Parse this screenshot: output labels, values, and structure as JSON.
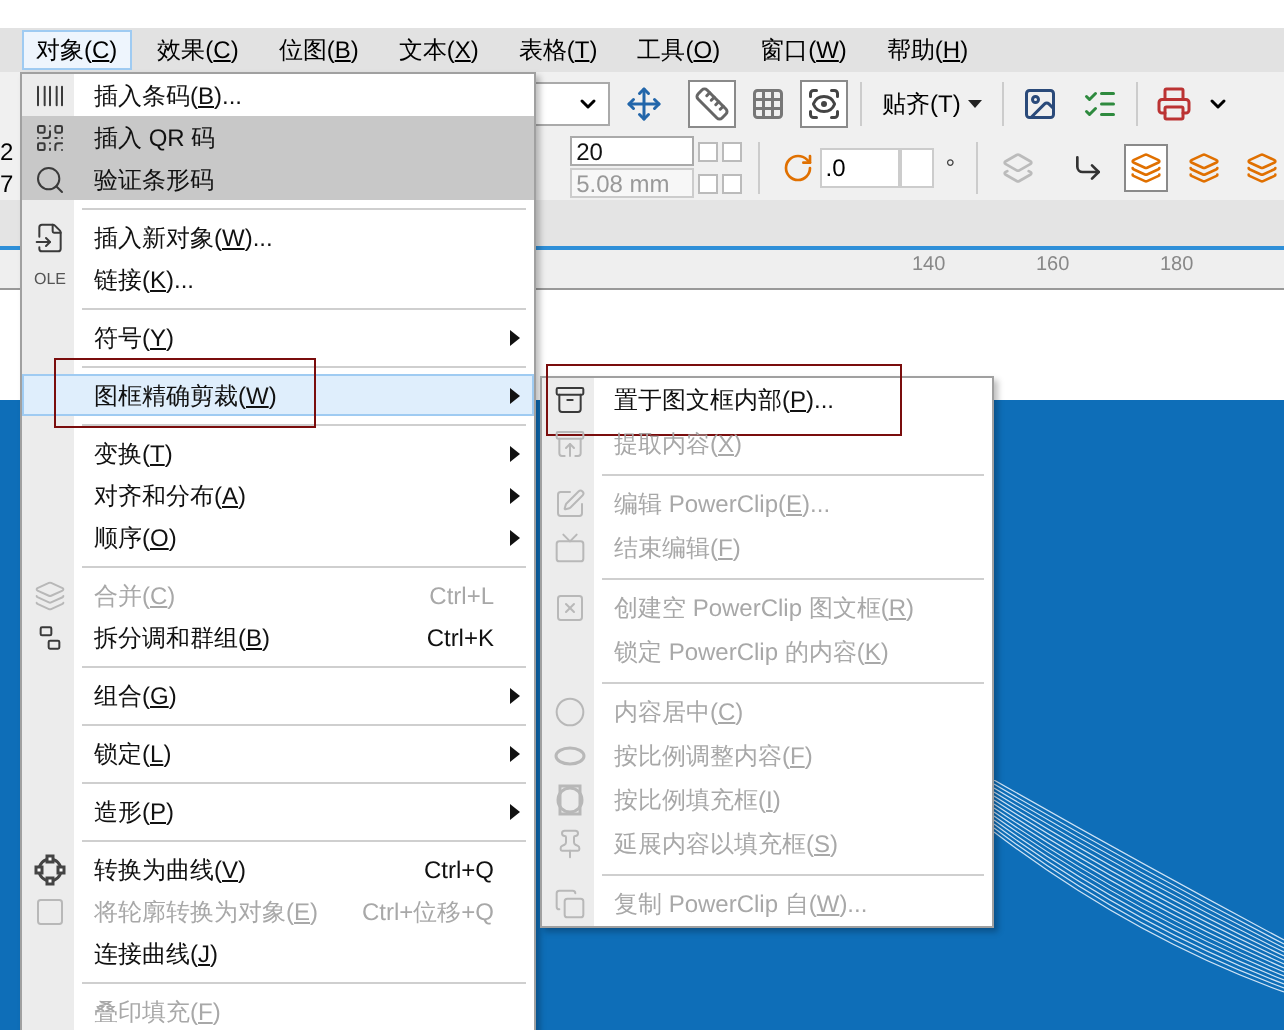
{
  "menu_bar": [
    {
      "label": "对象(C)",
      "selected": true
    },
    {
      "label": "效果(C)",
      "selected": false
    },
    {
      "label": "位图(B)",
      "selected": false
    },
    {
      "label": "文本(X)",
      "selected": false
    },
    {
      "label": "表格(T)",
      "selected": false
    },
    {
      "label": "工具(O)",
      "selected": false
    },
    {
      "label": "窗口(W)",
      "selected": false
    },
    {
      "label": "帮助(H)",
      "selected": false
    }
  ],
  "toolbar": {
    "left_edge_values": [
      "2",
      "7"
    ],
    "snap_button": "贴齐(T)",
    "outline_width_field": {
      "value": "20",
      "disabled": false
    },
    "nudge_field": {
      "value": "5.08 mm",
      "disabled": true
    },
    "angle_field": {
      "value": ".0"
    },
    "degree_sign": "°"
  },
  "ruler": {
    "labels": [
      "140",
      "160",
      "180"
    ]
  },
  "object_menu": {
    "items": [
      {
        "kind": "command",
        "label": "插入条码(B)...",
        "disabled": false,
        "hovered": false,
        "selected": false,
        "annotated": false
      },
      {
        "kind": "command",
        "label": "插入 QR 码",
        "disabled": false,
        "hovered": true,
        "selected": false,
        "annotated": false
      },
      {
        "kind": "command",
        "label": "验证条形码",
        "disabled": false,
        "hovered": true,
        "selected": false,
        "annotated": false
      },
      {
        "kind": "separator"
      },
      {
        "kind": "command",
        "label": "插入新对象(W)...",
        "disabled": false,
        "hovered": false,
        "selected": false,
        "annotated": false
      },
      {
        "kind": "command",
        "label": "链接(K)...",
        "icon_text": "OLE",
        "disabled": false,
        "hovered": false,
        "selected": false,
        "annotated": false
      },
      {
        "kind": "separator"
      },
      {
        "kind": "submenu",
        "label": "符号(Y)",
        "disabled": false,
        "hovered": false,
        "selected": false,
        "annotated": false
      },
      {
        "kind": "separator"
      },
      {
        "kind": "submenu",
        "label": "图框精确剪裁(W)",
        "disabled": false,
        "hovered": false,
        "selected": true,
        "annotated": true
      },
      {
        "kind": "separator"
      },
      {
        "kind": "submenu",
        "label": "变换(T)",
        "disabled": false,
        "hovered": false,
        "selected": false,
        "annotated": false
      },
      {
        "kind": "submenu",
        "label": "对齐和分布(A)",
        "disabled": false,
        "hovered": false,
        "selected": false,
        "annotated": false
      },
      {
        "kind": "submenu",
        "label": "顺序(O)",
        "disabled": false,
        "hovered": false,
        "selected": false,
        "annotated": false
      },
      {
        "kind": "separator"
      },
      {
        "kind": "command",
        "label": "合并(C)",
        "shortcut": "Ctrl+L",
        "disabled": true,
        "hovered": false,
        "selected": false,
        "annotated": false
      },
      {
        "kind": "command",
        "label": "拆分调和群组(B)",
        "shortcut": "Ctrl+K",
        "disabled": false,
        "hovered": false,
        "selected": false,
        "annotated": false
      },
      {
        "kind": "separator"
      },
      {
        "kind": "submenu",
        "label": "组合(G)",
        "disabled": false,
        "hovered": false,
        "selected": false,
        "annotated": false
      },
      {
        "kind": "separator"
      },
      {
        "kind": "submenu",
        "label": "锁定(L)",
        "disabled": false,
        "hovered": false,
        "selected": false,
        "annotated": false
      },
      {
        "kind": "separator"
      },
      {
        "kind": "submenu",
        "label": "造形(P)",
        "disabled": false,
        "hovered": false,
        "selected": false,
        "annotated": false
      },
      {
        "kind": "separator"
      },
      {
        "kind": "command",
        "label": "转换为曲线(V)",
        "shortcut": "Ctrl+Q",
        "disabled": false,
        "hovered": false,
        "selected": false,
        "annotated": false
      },
      {
        "kind": "command",
        "label": "将轮廓转换为对象(E)",
        "shortcut": "Ctrl+位移+Q",
        "disabled": true,
        "hovered": false,
        "selected": false,
        "annotated": false
      },
      {
        "kind": "command",
        "label": "连接曲线(J)",
        "disabled": false,
        "hovered": false,
        "selected": false,
        "annotated": false
      },
      {
        "kind": "separator"
      },
      {
        "kind": "command",
        "label": "叠印填充(F)",
        "disabled": true,
        "hovered": false,
        "selected": false,
        "annotated": false
      }
    ]
  },
  "powerclip_submenu": {
    "items": [
      {
        "kind": "command",
        "label": "置于图文框内部(P)...",
        "disabled": false,
        "hovered": false,
        "selected": false,
        "annotated": true
      },
      {
        "kind": "command",
        "label": "提取内容(X)",
        "disabled": true,
        "hovered": false,
        "selected": false,
        "annotated": false
      },
      {
        "kind": "separator"
      },
      {
        "kind": "command",
        "label": "编辑 PowerClip(E)...",
        "disabled": true,
        "hovered": false,
        "selected": false,
        "annotated": false
      },
      {
        "kind": "command",
        "label": "结束编辑(F)",
        "disabled": true,
        "hovered": false,
        "selected": false,
        "annotated": false
      },
      {
        "kind": "separator"
      },
      {
        "kind": "command",
        "label": "创建空 PowerClip 图文框(R)",
        "disabled": true,
        "hovered": false,
        "selected": false,
        "annotated": false
      },
      {
        "kind": "command",
        "label": "锁定 PowerClip 的内容(K)",
        "disabled": true,
        "hovered": false,
        "selected": false,
        "annotated": false
      },
      {
        "kind": "separator"
      },
      {
        "kind": "command",
        "label": "内容居中(C)",
        "disabled": true,
        "hovered": false,
        "selected": false,
        "annotated": false
      },
      {
        "kind": "command",
        "label": "按比例调整内容(F)",
        "disabled": true,
        "hovered": false,
        "selected": false,
        "annotated": false
      },
      {
        "kind": "command",
        "label": "按比例填充框(I)",
        "disabled": true,
        "hovered": false,
        "selected": false,
        "annotated": false
      },
      {
        "kind": "command",
        "label": "延展内容以填充框(S)",
        "disabled": true,
        "hovered": false,
        "selected": false,
        "annotated": false
      },
      {
        "kind": "separator"
      },
      {
        "kind": "command",
        "label": "复制 PowerClip 自(W)...",
        "disabled": true,
        "hovered": false,
        "selected": false,
        "annotated": false
      }
    ]
  }
}
